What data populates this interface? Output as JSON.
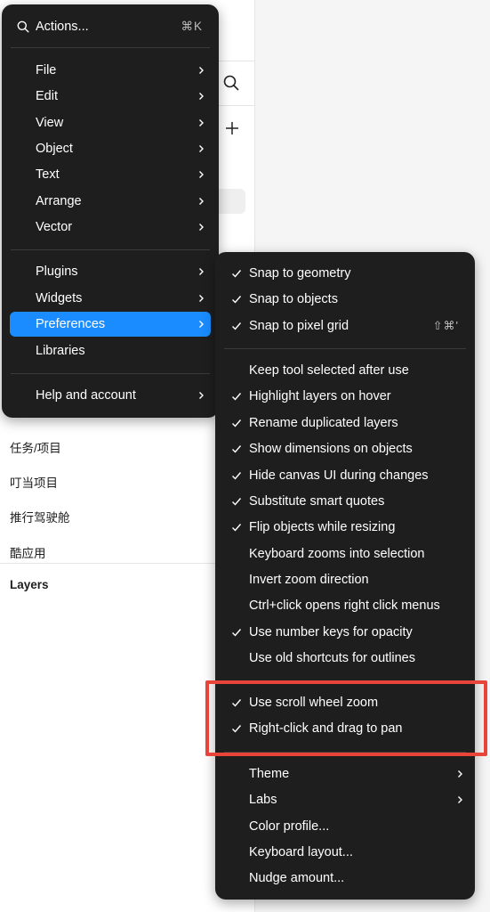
{
  "background": {
    "pages": [
      "任务/项目",
      "叮当项目",
      "推行驾驶舱",
      "酷应用"
    ],
    "layers_title": "Layers"
  },
  "main_menu": {
    "search": {
      "label": "Actions...",
      "shortcut": "⌘K",
      "icon": "search-icon"
    },
    "items": [
      {
        "label": "File",
        "submenu": true
      },
      {
        "label": "Edit",
        "submenu": true
      },
      {
        "label": "View",
        "submenu": true
      },
      {
        "label": "Object",
        "submenu": true
      },
      {
        "label": "Text",
        "submenu": true
      },
      {
        "label": "Arrange",
        "submenu": true
      },
      {
        "label": "Vector",
        "submenu": true
      },
      {
        "label": "Plugins",
        "submenu": true
      },
      {
        "label": "Widgets",
        "submenu": true
      },
      {
        "label": "Preferences",
        "submenu": true,
        "active": true
      },
      {
        "label": "Libraries",
        "submenu": false
      },
      {
        "label": "Help and account",
        "submenu": true
      }
    ]
  },
  "preferences_menu": {
    "items": [
      {
        "label": "Snap to geometry",
        "checked": true
      },
      {
        "label": "Snap to objects",
        "checked": true
      },
      {
        "label": "Snap to pixel grid",
        "checked": true,
        "shortcut": "⇧⌘'"
      },
      {
        "label": "Keep tool selected after use",
        "checked": false
      },
      {
        "label": "Highlight layers on hover",
        "checked": true
      },
      {
        "label": "Rename duplicated layers",
        "checked": true
      },
      {
        "label": "Show dimensions on objects",
        "checked": true
      },
      {
        "label": "Hide canvas UI during changes",
        "checked": true
      },
      {
        "label": "Substitute smart quotes",
        "checked": true
      },
      {
        "label": "Flip objects while resizing",
        "checked": true
      },
      {
        "label": "Keyboard zooms into selection",
        "checked": false
      },
      {
        "label": "Invert zoom direction",
        "checked": false
      },
      {
        "label": "Ctrl+click opens right click menus",
        "checked": false
      },
      {
        "label": "Use number keys for opacity",
        "checked": true
      },
      {
        "label": "Use old shortcuts for outlines",
        "checked": false
      },
      {
        "label": "Use scroll wheel zoom",
        "checked": true
      },
      {
        "label": "Right-click and drag to pan",
        "checked": true
      },
      {
        "label": "Theme",
        "submenu": true
      },
      {
        "label": "Labs",
        "submenu": true
      },
      {
        "label": "Color profile...",
        "submenu": false
      },
      {
        "label": "Keyboard layout...",
        "submenu": false
      },
      {
        "label": "Nudge amount...",
        "submenu": false
      }
    ]
  },
  "colors": {
    "menu_bg": "#1e1e1e",
    "active_item": "#1a8cff",
    "annotation_box": "#e8443a"
  }
}
